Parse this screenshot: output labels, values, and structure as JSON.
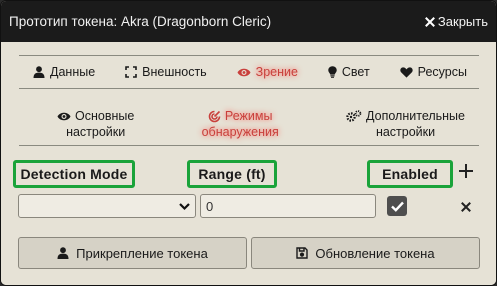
{
  "window": {
    "title": "Прототип токена: Akra (Dragonborn Cleric)",
    "close_label": "Закрыть"
  },
  "tabs": [
    {
      "label": "Данные",
      "icon": "user-icon",
      "active": false
    },
    {
      "label": "Внешность",
      "icon": "expand-icon",
      "active": false
    },
    {
      "label": "Зрение",
      "icon": "eye-icon",
      "active": true
    },
    {
      "label": "Свет",
      "icon": "lightbulb-icon",
      "active": false
    },
    {
      "label": "Ресурсы",
      "icon": "heart-icon",
      "active": false
    }
  ],
  "subtabs": [
    {
      "line1": "Основные",
      "line2": "настройки",
      "icon": "eye-icon",
      "active": false
    },
    {
      "line1": "Режимы",
      "line2": "обнаружения",
      "icon": "radar-icon",
      "active": true
    },
    {
      "line1": "Дополнительные",
      "line2": "настройки",
      "icon": "cogs-icon",
      "active": false
    }
  ],
  "detection": {
    "headers": {
      "mode": "Detection Mode",
      "range": "Range (ft)",
      "enabled": "Enabled"
    },
    "rows": [
      {
        "mode": "",
        "range": "0",
        "enabled": true
      }
    ]
  },
  "footer": {
    "attach_label": "Прикрепление токена",
    "update_label": "Обновление токена"
  },
  "colors": {
    "active_tab": "#c9403c",
    "highlight": "#1aa33a",
    "titlebar": "#1b1b1b",
    "panel": "#e6e2d6"
  }
}
